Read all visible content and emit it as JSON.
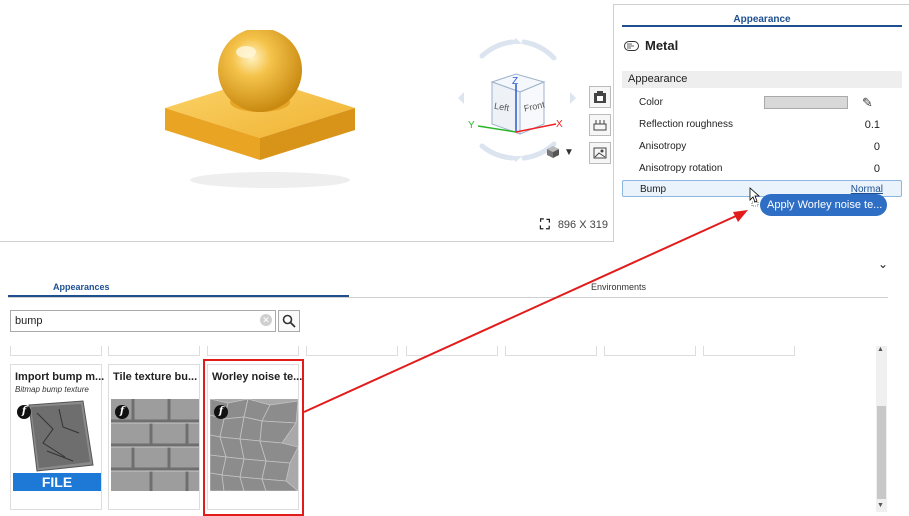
{
  "viewport": {
    "canvas_size": "896 X 319",
    "cube_labels": {
      "top": "Z",
      "left": "Left",
      "front": "Front",
      "x_axis": "X",
      "y_axis": "Y"
    }
  },
  "panel": {
    "tab": "Appearance",
    "title": "Metal",
    "section": "Appearance",
    "properties": [
      {
        "label": "Color",
        "value": ""
      },
      {
        "label": "Reflection roughness",
        "value": "0.1"
      },
      {
        "label": "Anisotropy",
        "value": "0"
      },
      {
        "label": "Anisotropy rotation",
        "value": "0"
      }
    ],
    "bump": {
      "label": "Bump",
      "value": "Normal"
    }
  },
  "drag_tooltip": "Apply Worley noise te...",
  "library": {
    "tabs": [
      {
        "label": "Appearances",
        "active": true
      },
      {
        "label": "Environments",
        "active": false
      }
    ],
    "search": {
      "value": "bump"
    },
    "cards": [
      {
        "title": "Import bump m...",
        "subtitle": "Bitmap bump texture",
        "badge": "f",
        "band": "FILE"
      },
      {
        "title": "Tile texture bu...",
        "subtitle": "",
        "badge": "f"
      },
      {
        "title": "Worley noise te...",
        "subtitle": "",
        "badge": "f"
      }
    ]
  },
  "colors": {
    "accent": "#1d4f91",
    "gold": "#f0b63a",
    "highlight": "#e21b1b",
    "tooltip": "#2e6ec4"
  }
}
